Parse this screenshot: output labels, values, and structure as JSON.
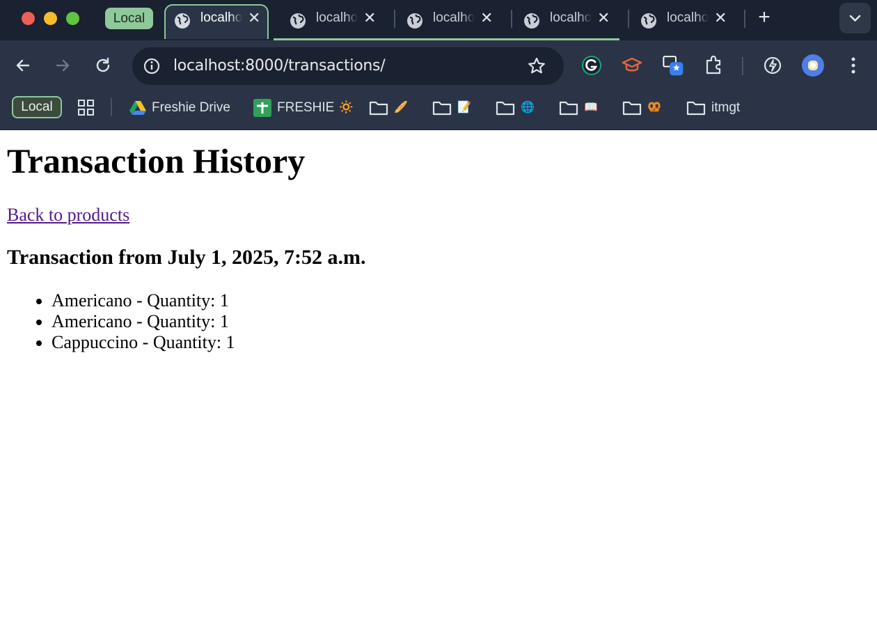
{
  "browser": {
    "tab_group_label": "Local",
    "tabs": [
      {
        "title": "localhost",
        "active": true
      },
      {
        "title": "localhost",
        "active": false
      },
      {
        "title": "localhost",
        "active": false
      },
      {
        "title": "localhost",
        "active": false
      },
      {
        "title": "localhost",
        "active": false
      }
    ],
    "address": "localhost:8000/transactions/",
    "bookmarks": {
      "group_label": "Local",
      "items": [
        {
          "label": "Freshie Drive",
          "icon": "google-drive-icon"
        },
        {
          "label": "FRESHIE 🔅",
          "icon": "green-plus-icon"
        },
        {
          "label": "",
          "icon": "folder-icon",
          "emoji": "🥖"
        },
        {
          "label": "",
          "icon": "folder-icon",
          "emoji": "📝"
        },
        {
          "label": "",
          "icon": "folder-icon",
          "emoji": "🌐"
        },
        {
          "label": "",
          "icon": "folder-icon",
          "emoji": "📖"
        },
        {
          "label": "",
          "icon": "folder-icon",
          "emoji": "🥨"
        },
        {
          "label": "itmgt",
          "icon": "folder-icon"
        }
      ]
    },
    "colors": {
      "tab_group": "#8fc89a",
      "chrome_dark": "#1a2130",
      "chrome": "#2a3446",
      "link_visited": "#551a8b"
    }
  },
  "page": {
    "title": "Transaction History",
    "back_link": "Back to products",
    "transaction_heading": "Transaction from July 1, 2025, 7:52 a.m.",
    "items": [
      "Americano - Quantity: 1",
      "Americano - Quantity: 1",
      "Cappuccino - Quantity: 1"
    ]
  }
}
